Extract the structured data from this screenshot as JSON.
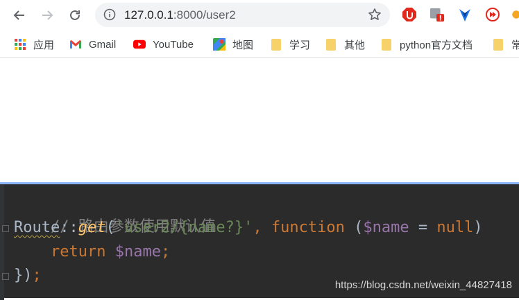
{
  "browser": {
    "url_host": "127.0.0.1",
    "url_path": ":8000/user2"
  },
  "bookmarks": [
    {
      "label": "应用",
      "icon": "apps-grid-icon"
    },
    {
      "label": "Gmail",
      "icon": "gmail-icon"
    },
    {
      "label": "YouTube",
      "icon": "youtube-icon"
    },
    {
      "label": "地图",
      "icon": "maps-icon"
    },
    {
      "label": "学习",
      "icon": "folder-icon"
    },
    {
      "label": "其他",
      "icon": "folder-icon"
    },
    {
      "label": "python官方文档",
      "icon": "folder-icon"
    },
    {
      "label": "常",
      "icon": "folder-icon"
    }
  ],
  "editor": {
    "comment": "// 路由参数使用默认值",
    "line2": {
      "class_name": "Route",
      "op": "::",
      "method": "get",
      "paren_open": "(",
      "route_string": "'user2/{name?}'",
      "comma": ", ",
      "func_kw": "function",
      "space_paren": " (",
      "param": "$name",
      "eq": " = ",
      "null_kw": "null",
      "paren_close": ")"
    },
    "line3": {
      "indent": "    ",
      "return_kw": "return",
      "space": " ",
      "var": "$name",
      "semi": ";"
    },
    "line4": {
      "close": "})",
      "semi": ";"
    }
  },
  "watermark": "https://blog.csdn.net/weixin_44827418"
}
